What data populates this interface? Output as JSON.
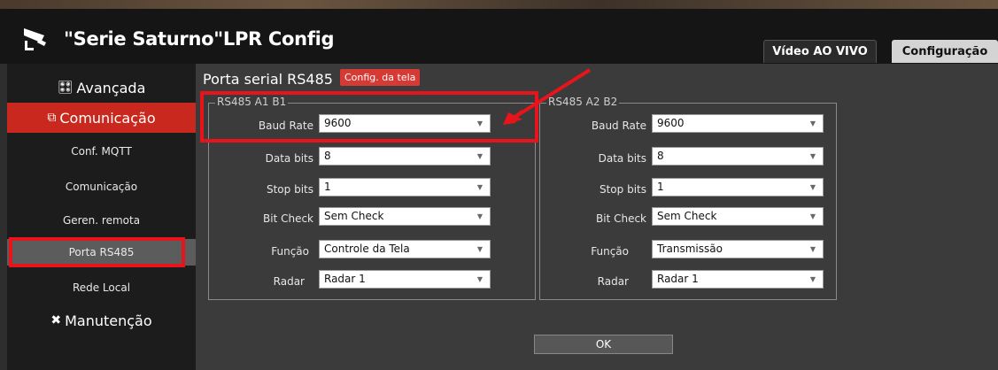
{
  "app": {
    "title": "\"Serie Saturno\"LPR Config"
  },
  "tabs": {
    "live": "Vídeo AO VIVO",
    "config": "Configuração"
  },
  "sidebar": {
    "advanced": "Avançada",
    "communication": "Comunicação",
    "items": [
      "Conf. MQTT",
      "Comunicação",
      "Geren. remota",
      "Porta RS485",
      "Rede Local"
    ],
    "maintenance": "Manutenção"
  },
  "page": {
    "title": "Porta serial RS485",
    "badge": "Config. da tela"
  },
  "group_a": {
    "legend": "RS485 A1 B1",
    "labels": [
      "Baud Rate",
      "Data bits",
      "Stop bits",
      "Bit Check",
      "Função",
      "Radar"
    ],
    "values": [
      "9600",
      "8",
      "1",
      "Sem Check",
      "Controle da Tela",
      "Radar 1"
    ]
  },
  "group_b": {
    "legend": "RS485  A2 B2",
    "labels": [
      "Baud Rate",
      "Data bits",
      "Stop bits",
      "Bit Check",
      "Função",
      "Radar"
    ],
    "values": [
      "9600",
      "8",
      "1",
      "Sem Check",
      "Transmissão",
      "Radar 1"
    ]
  },
  "ok_label": "OK",
  "colors": {
    "accent": "#c9281e",
    "annotation": "#e8141b"
  }
}
